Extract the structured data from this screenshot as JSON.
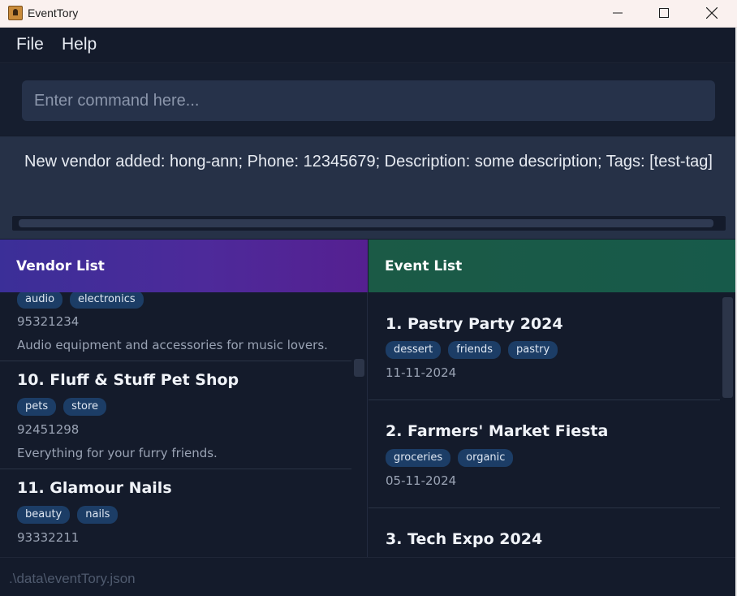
{
  "window": {
    "title": "EventTory"
  },
  "menu": {
    "items": [
      "File",
      "Help"
    ]
  },
  "command": {
    "placeholder": "Enter command here...",
    "value": ""
  },
  "result": {
    "message": "New vendor added: hong-ann; Phone: 12345679; Description: some description; Tags: [test-tag]"
  },
  "vendor_panel": {
    "title": "Vendor List",
    "cards": [
      {
        "name": "",
        "tags": [
          "audio",
          "electronics"
        ],
        "phone": "95321234",
        "description": "Audio equipment and accessories for music lovers."
      },
      {
        "name": "10. Fluff & Stuff Pet Shop",
        "tags": [
          "pets",
          "store"
        ],
        "phone": "92451298",
        "description": "Everything for your furry friends."
      },
      {
        "name": "11. Glamour Nails",
        "tags": [
          "beauty",
          "nails"
        ],
        "phone": "93332211",
        "description": ""
      }
    ]
  },
  "event_panel": {
    "title": "Event List",
    "cards": [
      {
        "name": "1. Pastry Party 2024",
        "tags": [
          "dessert",
          "friends",
          "pastry"
        ],
        "date": "11-11-2024"
      },
      {
        "name": "2. Farmers' Market Fiesta",
        "tags": [
          "groceries",
          "organic"
        ],
        "date": "05-11-2024"
      },
      {
        "name": "3. Tech Expo 2024",
        "tags": [],
        "date": ""
      }
    ]
  },
  "status": {
    "file_path": ".\\data\\eventTory.json"
  },
  "colors": {
    "background": "#141b2b",
    "vendor_header": "#4d2a9a",
    "event_header": "#175a4a",
    "tag": "#1c3d66"
  }
}
